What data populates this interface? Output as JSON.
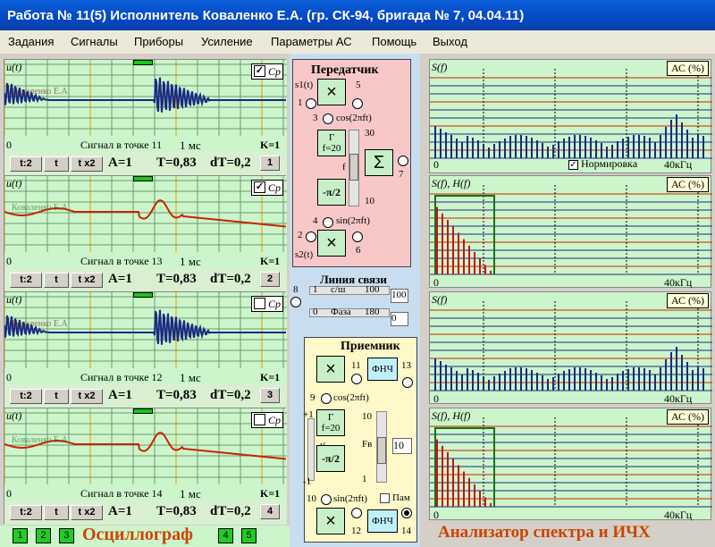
{
  "window": {
    "title": "Работа № 11(5)  Исполнитель Коваленко Е.А. (гр. СК-94, бригада № 7, 04.04.11)"
  },
  "menu": [
    "Задания",
    "Сигналы",
    "Приборы",
    "Усиление",
    "Параметры АС",
    "Помощь",
    "Выход"
  ],
  "osc": {
    "ylabel": "u(t)",
    "cp": "Cp",
    "signal_prefix": "Сигнал в точке",
    "time": "1 мс",
    "zero": "0",
    "btn_t2": "t:2",
    "btn_t": "t",
    "btn_tx2": "t x2",
    "A": "A=1",
    "T": "T=0,83",
    "dT": "dT=0,2",
    "k": "K=1",
    "channels": [
      {
        "point": "11",
        "num": "1",
        "watermark": "Коваленко Е.А"
      },
      {
        "point": "13",
        "num": "2",
        "watermark": "Коваленко Е.А"
      },
      {
        "point": "12",
        "num": "3",
        "watermark": "Коваленко Е.А"
      },
      {
        "point": "14",
        "num": "4",
        "watermark": "Коваленко Е.А"
      }
    ],
    "footer": "Осциллограф",
    "tabs": [
      "1",
      "2",
      "3",
      "4",
      "5"
    ]
  },
  "tx": {
    "title": "Передатчик",
    "s1": "s1(t)",
    "s2": "s2(t)",
    "cos": "cos(2πft)",
    "sin": "sin(2πft)",
    "gen": "Г",
    "f": "f=20",
    "phase": "-π/2",
    "sum": "Σ",
    "n1": "1",
    "n2": "2",
    "n3": "3",
    "n4": "4",
    "n5": "5",
    "n6": "6",
    "n7": "7",
    "scale_top": "30",
    "scale_bot": "10",
    "f_lbl": "f"
  },
  "link": {
    "title": "Линия связи",
    "snr": "с/ш",
    "snr_lo": "1",
    "snr_hi": "100",
    "snr_val": "100",
    "phase": "Фаза",
    "ph_lo": "0",
    "ph_hi": "180",
    "ph_val": "0",
    "n8": "8"
  },
  "rx": {
    "title": "Приемник",
    "cos": "cos(2πft)",
    "sin": "sin(2πft)",
    "gen": "Г",
    "f": "f=20",
    "phase": "-π/2",
    "lpf": "ФНЧ",
    "n9": "9",
    "n10": "10",
    "n11": "11",
    "n12": "12",
    "n13": "13",
    "n14": "14",
    "df": "df",
    "plus1": "+1",
    "minus1": "-1",
    "fv": "Fв",
    "fv_top": "10",
    "fv_bot": "1",
    "fv_val": "10",
    "mem": "Пам"
  },
  "spec": {
    "panels": [
      {
        "ylabel": "S(f)",
        "ac": "АС (%)",
        "khz": "40кГц",
        "zero": "0"
      },
      {
        "ylabel": "S(f), H(f)",
        "ac": "АС (%)",
        "khz": "40кГц",
        "zero": "0"
      },
      {
        "ylabel": "S(f)",
        "ac": "АС (%)",
        "khz": "40кГц",
        "zero": "0"
      },
      {
        "ylabel": "S(f), H(f)",
        "ac": "АС (%)",
        "khz": "40кГц",
        "zero": "0"
      }
    ],
    "norm": "Нормировка",
    "footer": "Анализатор спектра и ИЧХ"
  },
  "colors": {
    "plot_bg": "#ccf5cc",
    "signal_blue": "#1a2a80",
    "signal_red": "#cc2200",
    "tx_bg": "#f8c8c8",
    "rx_bg": "#fff8c8",
    "footer_red": "#cc4400"
  }
}
